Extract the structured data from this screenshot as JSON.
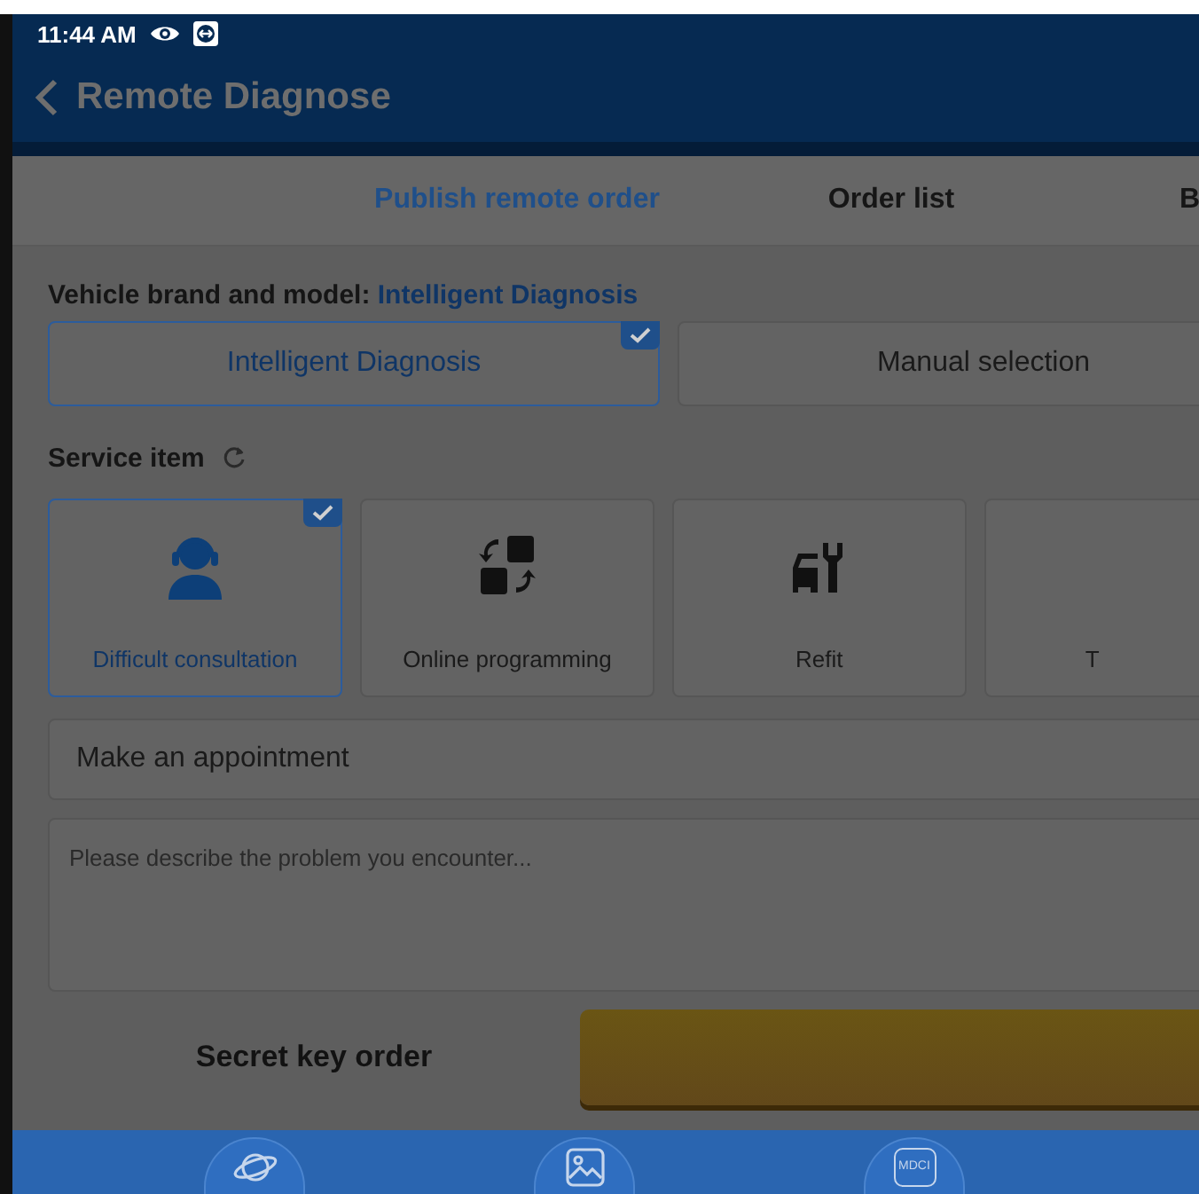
{
  "status_bar": {
    "time": "11:44 AM"
  },
  "header": {
    "title": "Remote Diagnose"
  },
  "tabs": [
    {
      "label": "Publish remote order",
      "selected": true
    },
    {
      "label": "Order list",
      "selected": false
    },
    {
      "label": "B",
      "selected": false
    }
  ],
  "vehicle": {
    "label": "Vehicle brand and model:",
    "value": "Intelligent Diagnosis",
    "options": [
      {
        "label": "Intelligent Diagnosis",
        "selected": true
      },
      {
        "label": "Manual selection",
        "selected": false
      }
    ]
  },
  "service": {
    "label": "Service item",
    "items": [
      {
        "kind": "consultation",
        "label": "Difficult consultation",
        "selected": true
      },
      {
        "kind": "programming",
        "label": "Online programming",
        "selected": false
      },
      {
        "kind": "refit",
        "label": "Refit",
        "selected": false
      },
      {
        "kind": "none",
        "label": "T",
        "selected": false
      }
    ]
  },
  "appointment": {
    "value": "Make an appointment"
  },
  "description": {
    "placeholder": "Please describe the problem you encounter..."
  },
  "secret_key": {
    "label": "Secret key order"
  },
  "bottom_nav": [
    {
      "kind": "planet"
    },
    {
      "kind": "image"
    },
    {
      "kind": "mdci",
      "label": "MDCI"
    }
  ]
}
